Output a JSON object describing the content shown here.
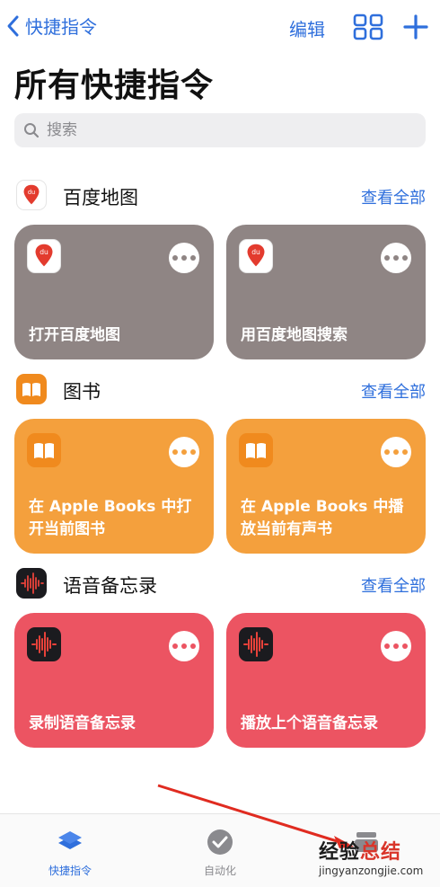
{
  "header": {
    "back_label": "快捷指令",
    "edit_label": "编辑",
    "grid_icon": "grid-view-icon",
    "add_icon": "plus-icon"
  },
  "page_title": "所有快捷指令",
  "search": {
    "placeholder": "搜索",
    "value": ""
  },
  "colors": {
    "accent": "#2f6fdc",
    "baidu_card": "#8f8584",
    "books_card": "#f4a03d",
    "voice_card": "#ec5462"
  },
  "sections": [
    {
      "title": "百度地图",
      "see_all": "查看全部",
      "icon": "baidu-map-icon",
      "cards": [
        {
          "label": "打开百度地图"
        },
        {
          "label": "用百度地图搜索"
        }
      ]
    },
    {
      "title": "图书",
      "see_all": "查看全部",
      "icon": "books-icon",
      "cards": [
        {
          "label": "在 Apple Books 中打开当前图书"
        },
        {
          "label": "在 Apple Books 中播放当前有声书"
        }
      ]
    },
    {
      "title": "语音备忘录",
      "see_all": "查看全部",
      "icon": "voice-memos-icon",
      "cards": [
        {
          "label": "录制语音备忘录"
        },
        {
          "label": "播放上个语音备忘录"
        }
      ]
    }
  ],
  "tabbar": {
    "tabs": [
      {
        "label": "快捷指令",
        "icon": "shortcuts-icon",
        "active": true
      },
      {
        "label": "自动化",
        "icon": "automation-icon",
        "active": false
      },
      {
        "label": "",
        "icon": "gallery-icon",
        "active": false
      }
    ]
  },
  "watermark": {
    "line1_a": "经验",
    "line1_b": "总结",
    "line2": "jingyanzongjie.com"
  }
}
